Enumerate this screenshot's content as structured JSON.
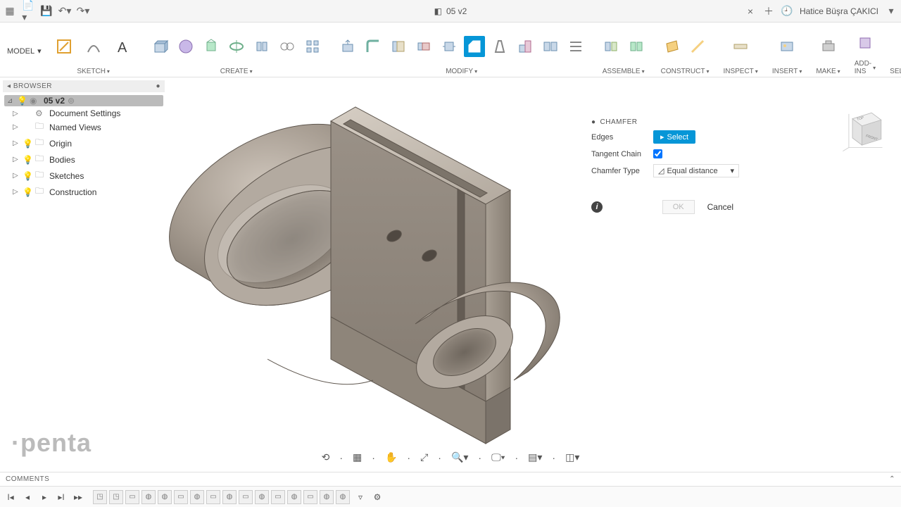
{
  "app": {
    "doc_title": "05 v2",
    "user_name": "Hatice Büşra ÇAKICI"
  },
  "ribbon": {
    "workspace": "MODEL",
    "groups": {
      "sketch": "SKETCH",
      "create": "CREATE",
      "modify": "MODIFY",
      "assemble": "ASSEMBLE",
      "construct": "CONSTRUCT",
      "inspect": "INSPECT",
      "insert": "INSERT",
      "make": "MAKE",
      "addins": "ADD-INS",
      "select": "SELECT"
    }
  },
  "browser": {
    "title": "BROWSER",
    "root": "05 v2",
    "items": [
      {
        "label": "Document Settings",
        "icon": "gear"
      },
      {
        "label": "Named Views",
        "icon": "folder"
      },
      {
        "label": "Origin",
        "icon": "folder"
      },
      {
        "label": "Bodies",
        "icon": "folder"
      },
      {
        "label": "Sketches",
        "icon": "folder"
      },
      {
        "label": "Construction",
        "icon": "folder"
      }
    ]
  },
  "chamfer_panel": {
    "title": "CHAMFER",
    "edges_label": "Edges",
    "edges_value": "Select",
    "tangent_label": "Tangent Chain",
    "tangent_checked": true,
    "type_label": "Chamfer Type",
    "type_value": "Equal distance",
    "ok": "OK",
    "cancel": "Cancel"
  },
  "comments": {
    "title": "COMMENTS"
  },
  "logo": "penta",
  "viewcube": {
    "label_top": "TOP",
    "label_front": "FRONT"
  },
  "timeline_steps_count": 16,
  "colors": {
    "accent": "#0696d7",
    "part_base": "#9d938a",
    "part_light": "#c9c1b8",
    "part_dark": "#6f665e"
  }
}
